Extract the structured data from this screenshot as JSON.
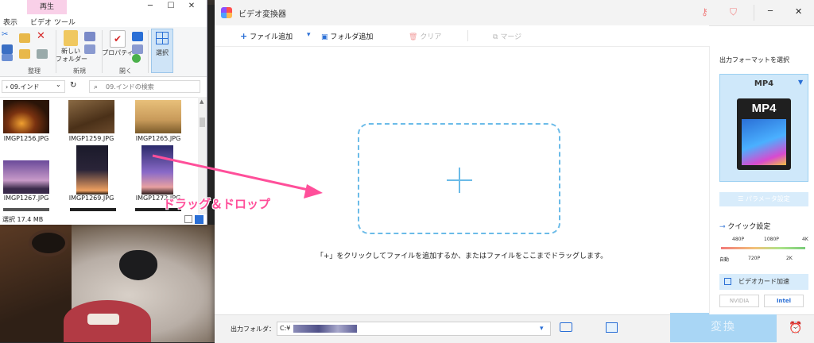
{
  "explorer": {
    "context_tab": "再生",
    "tabs": [
      "表示",
      "ビデオ ツール"
    ],
    "ribbon": {
      "new_folder": "新しい\nフォルダー",
      "properties": "プロパティ",
      "select": "選択",
      "groups": [
        "整理",
        "新規",
        "開く"
      ]
    },
    "address": "09.インド",
    "search_placeholder": "09.インドの検索",
    "files": [
      {
        "name": "IMGP1256.JPG",
        "color": "#5a2a14"
      },
      {
        "name": "IMGP1259.JPG",
        "color": "#6b4a2c"
      },
      {
        "name": "IMGP1265.JPG",
        "color": "#c89a5a"
      },
      {
        "name": "IMGP1267.JPG",
        "color": "#6a4a8a"
      },
      {
        "name": "IMGP1269.JPG",
        "color": "#2a2438"
      },
      {
        "name": "IMGP1272.JPG",
        "color": "#4a3a7a"
      }
    ],
    "status": "選択  17.4 MB"
  },
  "app": {
    "title": "ビデオ変換器",
    "toolbar": {
      "add_file": "ファイル追加",
      "add_folder": "フォルダ追加",
      "clear": "クリア",
      "merge": "マージ"
    },
    "drop_hint": "「+」をクリックしてファイルを追加するか、またはファイルをここまでドラッグします。",
    "output_folder_label": "出力フォルダ：",
    "output_path": "C:¥",
    "convert_label": "変換"
  },
  "panel": {
    "title": "出力フォーマットを選択",
    "format": "MP4",
    "format_icon_label": "MP4",
    "param_settings": "パラメータ設定",
    "quick_settings": "クイック設定",
    "quality_top": [
      "480P",
      "1080P",
      "4K"
    ],
    "quality_bottom": [
      "自動",
      "720P",
      "2K"
    ],
    "gpu_accel": "ビデオカード加速",
    "vendors": [
      "NVIDIA",
      "Intel"
    ]
  },
  "overlay": {
    "label": "ドラッグ＆ドロップ",
    "arrow_color": "#ff4f9a"
  },
  "colors": {
    "accent": "#3a8fd8",
    "dropzone_border": "#6bbbe8",
    "convert_bg": "#a9d6f5"
  }
}
